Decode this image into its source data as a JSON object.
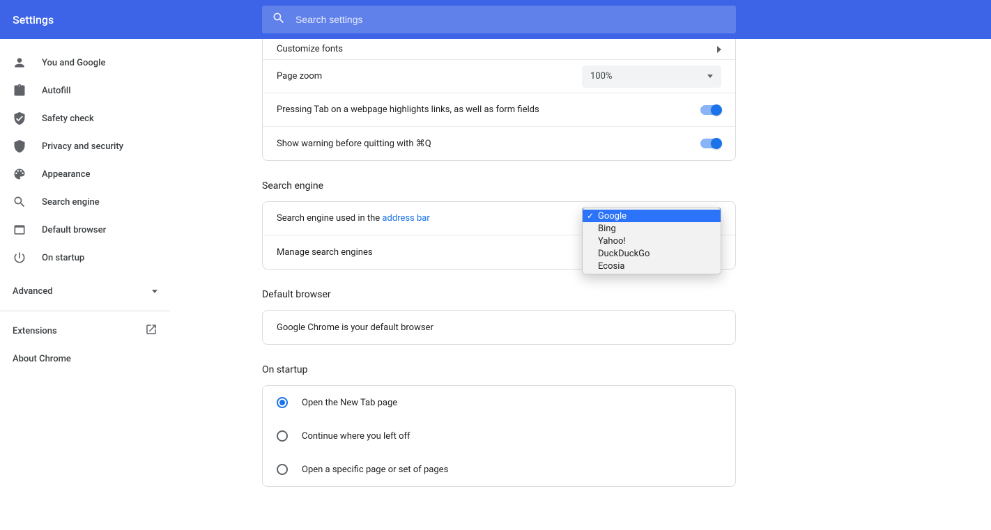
{
  "header": {
    "title": "Settings",
    "search_placeholder": "Search settings"
  },
  "sidebar": {
    "items": [
      {
        "label": "You and Google",
        "icon": "person"
      },
      {
        "label": "Autofill",
        "icon": "clipboard"
      },
      {
        "label": "Safety check",
        "icon": "shield-check"
      },
      {
        "label": "Privacy and security",
        "icon": "shield"
      },
      {
        "label": "Appearance",
        "icon": "palette"
      },
      {
        "label": "Search engine",
        "icon": "search"
      },
      {
        "label": "Default browser",
        "icon": "window"
      },
      {
        "label": "On startup",
        "icon": "power"
      }
    ],
    "advanced": "Advanced",
    "extensions": "Extensions",
    "about": "About Chrome"
  },
  "appearance": {
    "customize_fonts": "Customize fonts",
    "page_zoom_label": "Page zoom",
    "page_zoom_value": "100%",
    "tab_highlight": "Pressing Tab on a webpage highlights links, as well as form fields",
    "quit_warning": "Show warning before quitting with ⌘Q"
  },
  "search_engine": {
    "title": "Search engine",
    "used_in_prefix": "Search engine used in the ",
    "used_in_link": "address bar",
    "selected": "Google",
    "options": [
      "Google",
      "Bing",
      "Yahoo!",
      "DuckDuckGo",
      "Ecosia"
    ],
    "manage": "Manage search engines"
  },
  "default_browser": {
    "title": "Default browser",
    "message": "Google Chrome is your default browser"
  },
  "on_startup": {
    "title": "On startup",
    "options": [
      "Open the New Tab page",
      "Continue where you left off",
      "Open a specific page or set of pages"
    ],
    "selected_index": 0
  }
}
